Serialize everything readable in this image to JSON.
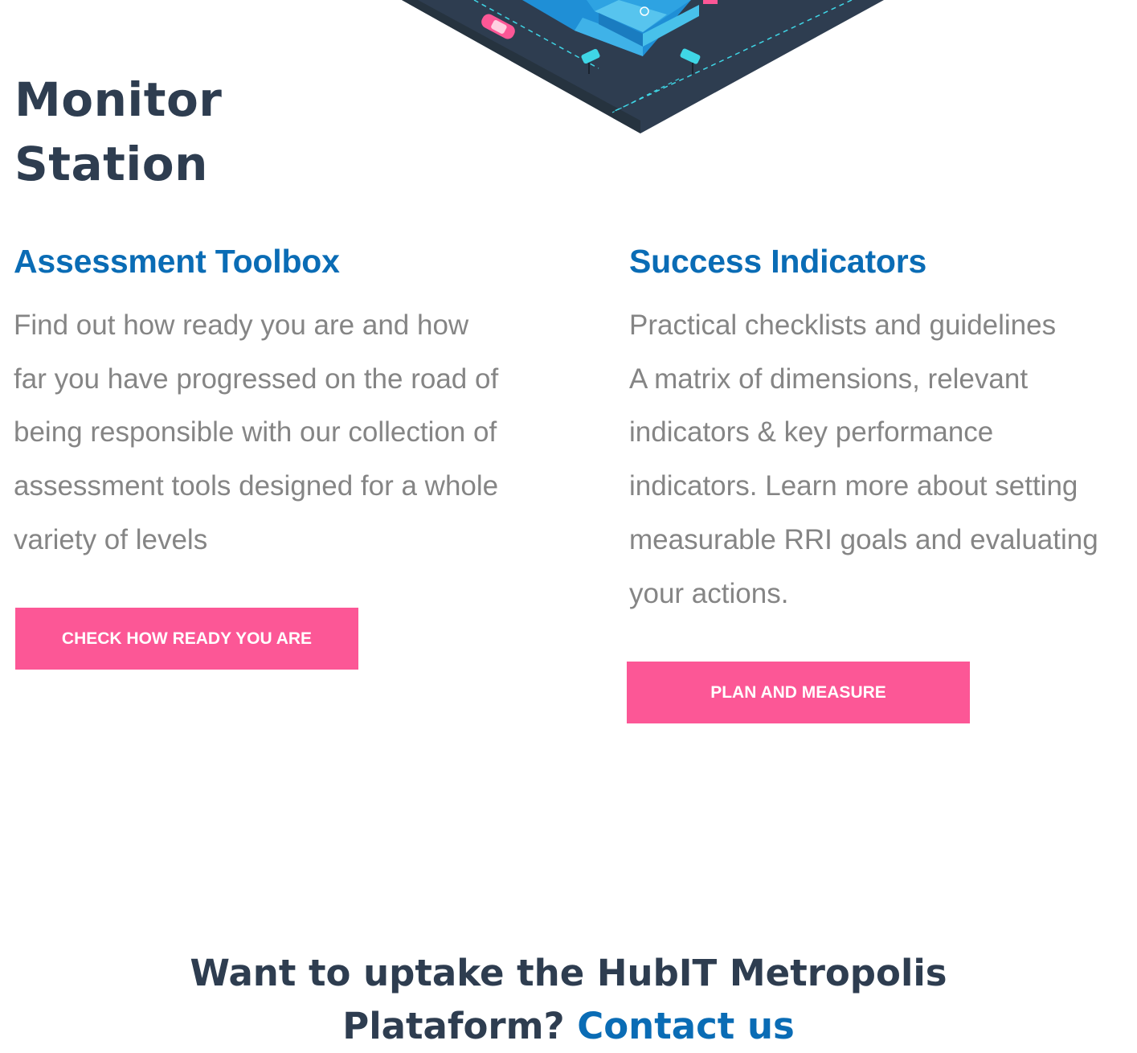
{
  "colors": {
    "dark_navy": "#2e3d50",
    "link_blue": "#0a6cb5",
    "body_gray": "#858585",
    "button_pink": "#fc5796",
    "illustration_cyan": "#3fd6e6"
  },
  "section": {
    "title_line1": "Monitor",
    "title_line2": "Station"
  },
  "assessment": {
    "heading": "Assessment Toolbox",
    "lines": [
      "Find out how ready you are and how",
      "far you have progressed on the road of",
      "being responsible with our collection of",
      "assessment tools designed for a whole",
      "variety of levels"
    ],
    "button_label": "CHECK HOW READY YOU ARE"
  },
  "success": {
    "heading": "Success Indicators",
    "lines": [
      "Practical checklists and guidelines",
      "A matrix of dimensions, relevant",
      "indicators & key performance",
      "indicators. Learn more about setting",
      "measurable RRI goals and evaluating",
      "your actions."
    ],
    "button_label": "PLAN AND MEASURE"
  },
  "footer": {
    "line1": "Want to uptake the HubIT Metropolis",
    "line2": "Plataform?",
    "contact_link": "Contact us"
  }
}
